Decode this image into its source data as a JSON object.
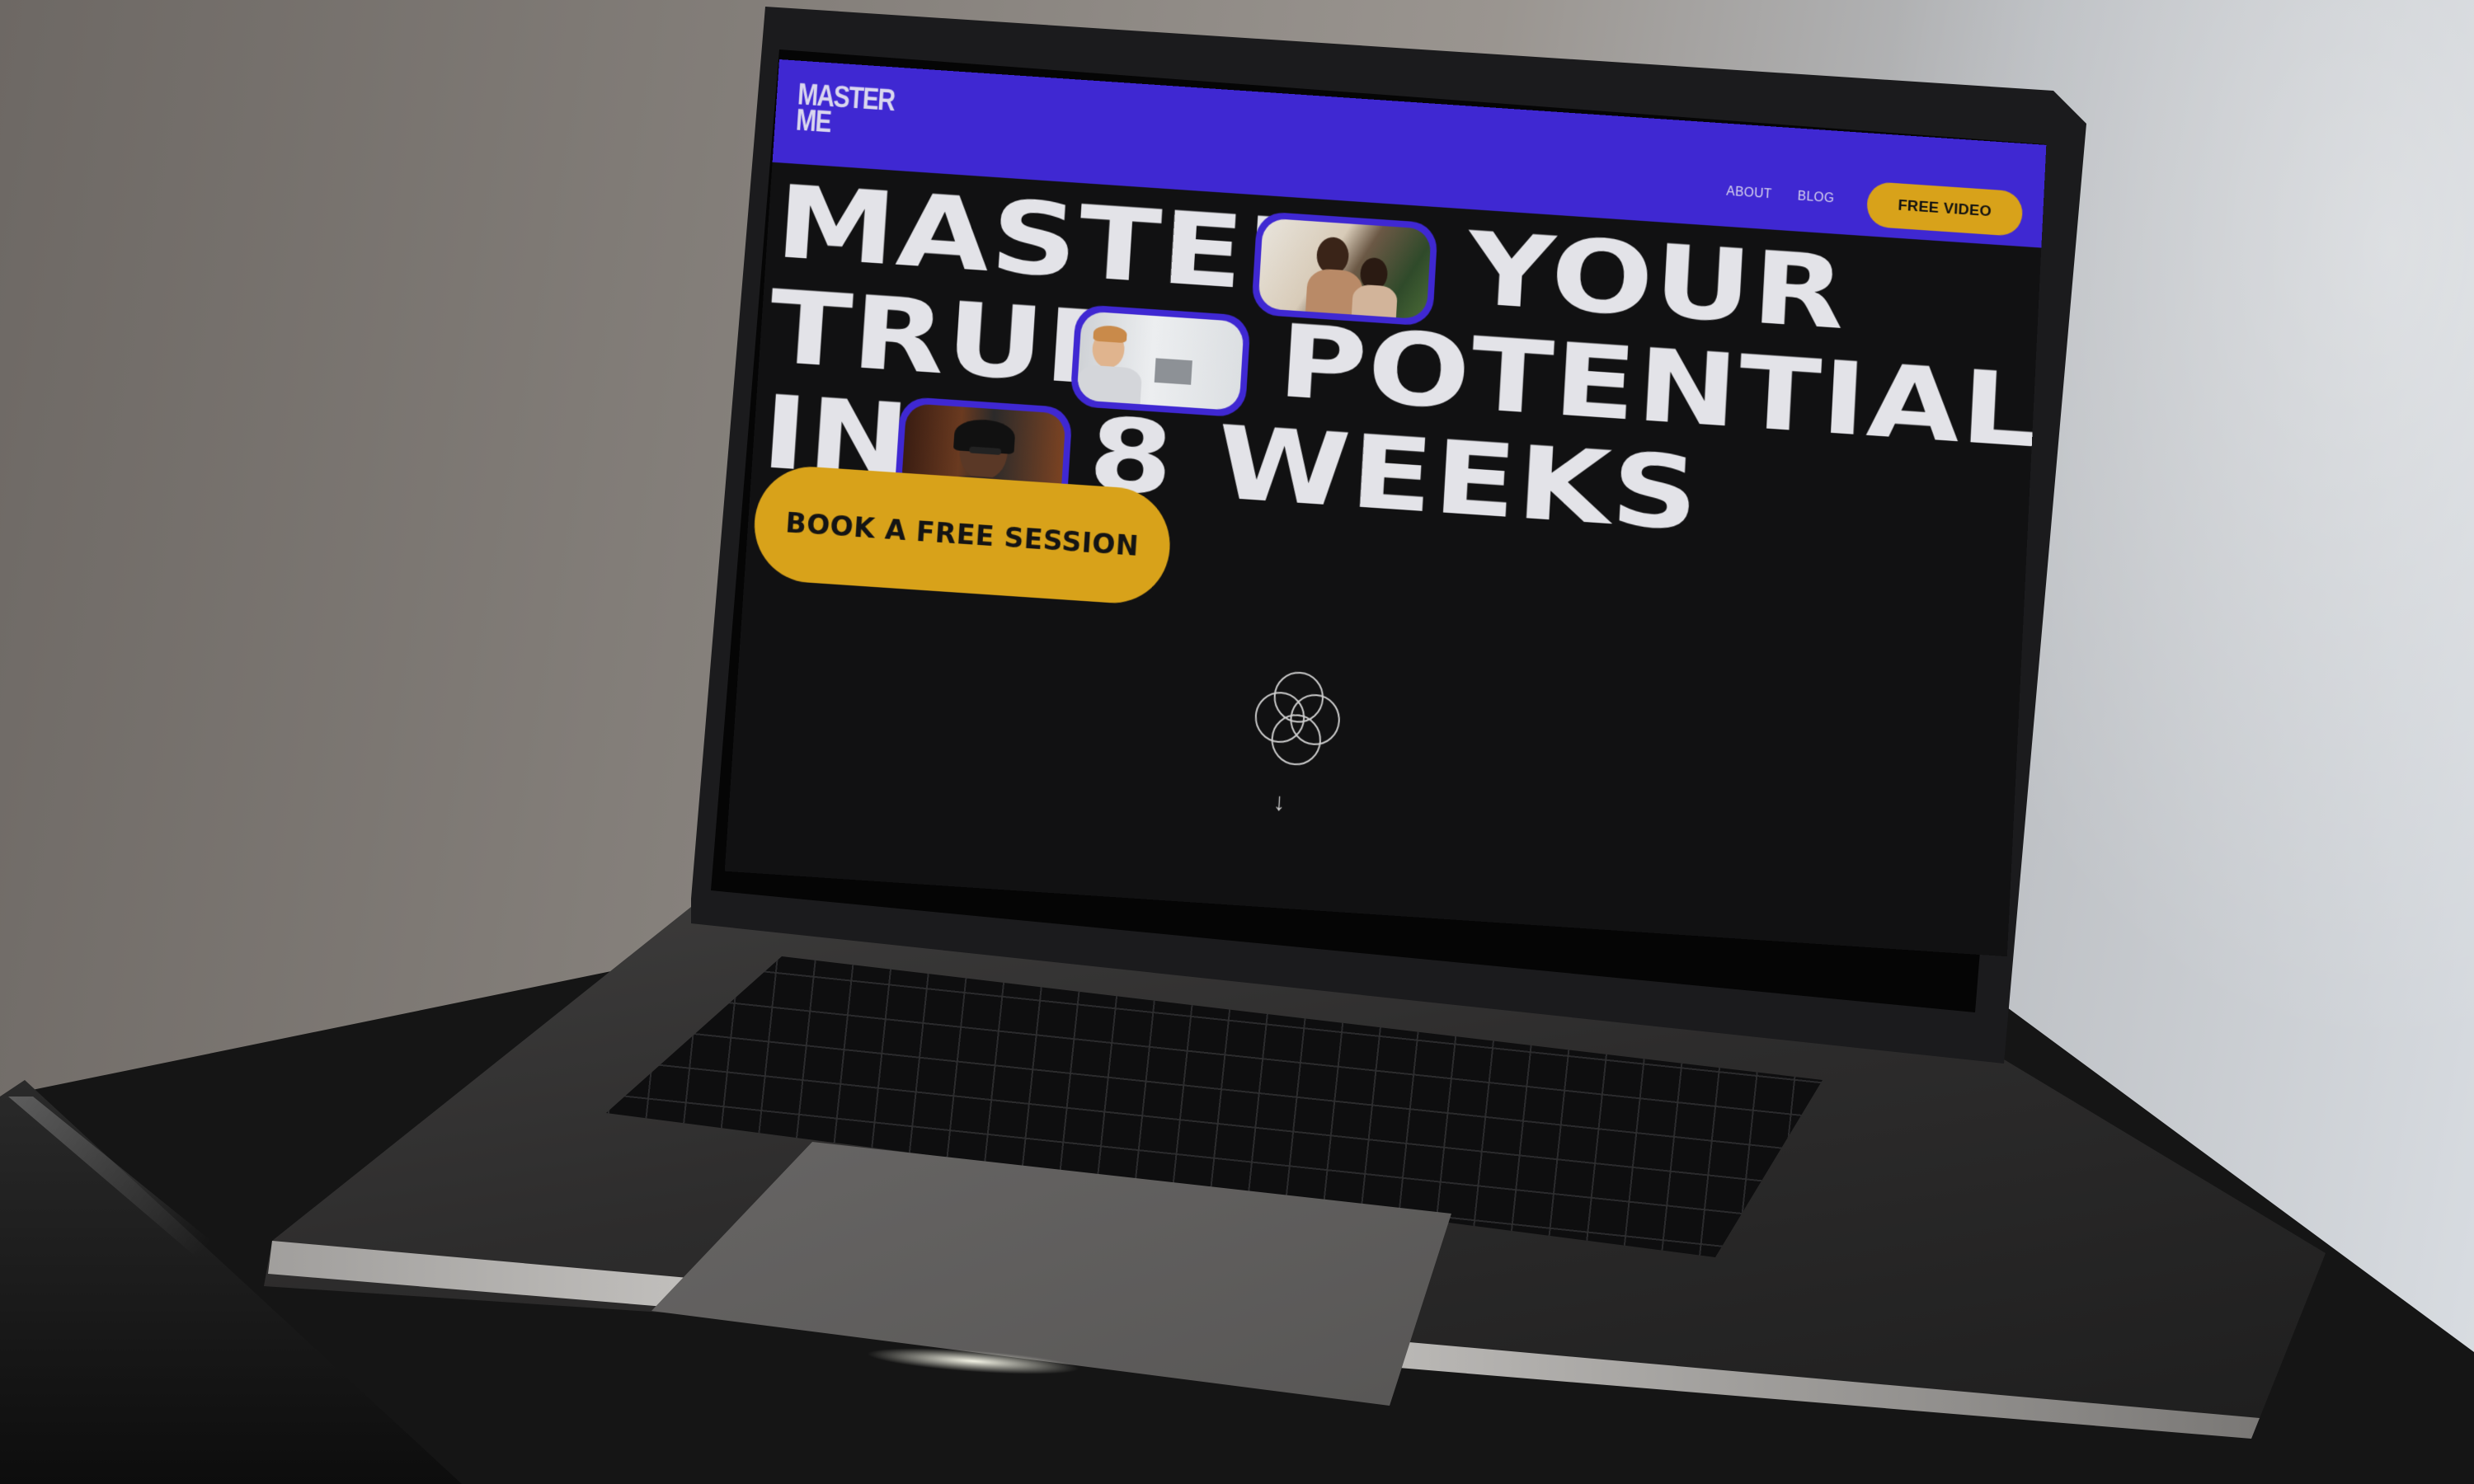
{
  "site": {
    "logo": "MASTER\nME",
    "nav": {
      "about": "ABOUT",
      "blog": "BLOG",
      "cta": "FREE VIDEO"
    },
    "hero": {
      "line1_a": "MASTER",
      "line1_b": "YOUR",
      "line2_a": "TRUE",
      "line2_b": "POTENTIAL",
      "line3_a": "IN",
      "line3_b": "8 WEEKS",
      "button": "BOOK A FREE SESSION"
    },
    "icons": [
      "flower-of-life-icon",
      "arrow-down-icon"
    ],
    "colors": {
      "nav_bg": "#3f28d2",
      "accent": "#d8a21a",
      "page_bg": "#111112",
      "text": "#e3e3e8"
    }
  }
}
